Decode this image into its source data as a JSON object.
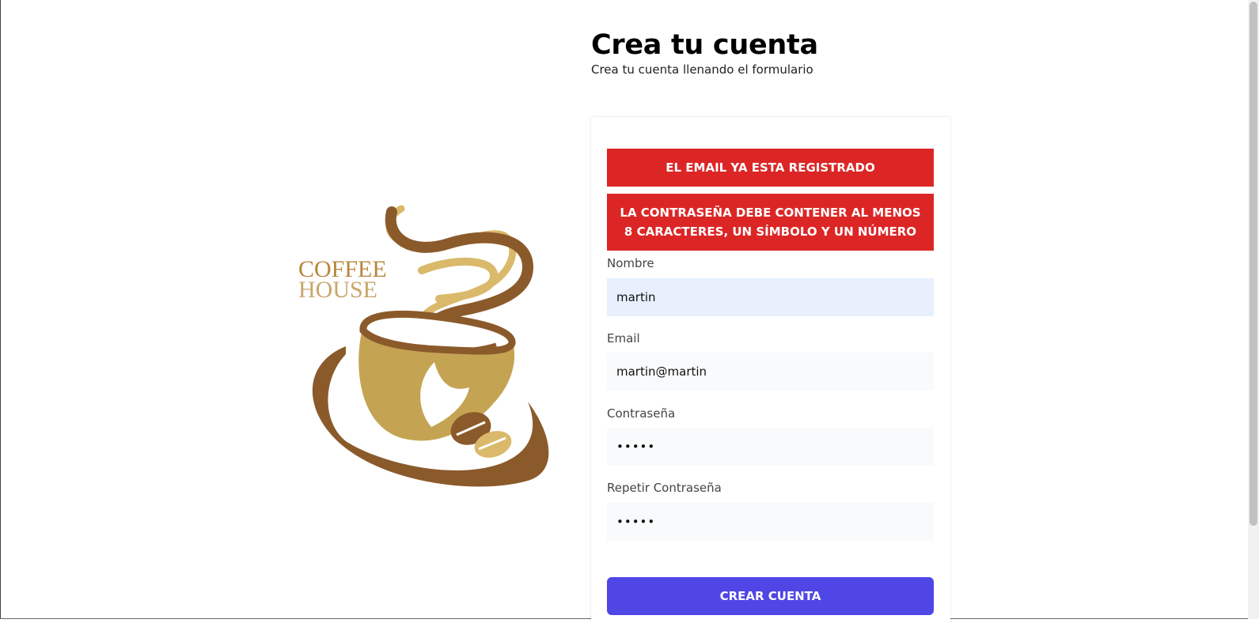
{
  "header": {
    "title": "Crea tu cuenta",
    "subtitle": "Crea tu cuenta llenando el formulario"
  },
  "logo": {
    "line1": "COFFEE",
    "line2": "HOUSE",
    "colors": {
      "brown": "#8b5a2b",
      "gold": "#c4a453",
      "light_gold": "#dab96a"
    }
  },
  "alerts": [
    "EL EMAIL YA ESTA REGISTRADO",
    "LA CONTRASEÑA DEBE CONTENER AL MENOS 8 CARACTERES, UN SÍMBOLO Y UN NÚMERO"
  ],
  "form": {
    "nombre": {
      "label": "Nombre",
      "value": "martin"
    },
    "email": {
      "label": "Email",
      "value": "martin@martin"
    },
    "password": {
      "label": "Contraseña",
      "value": "12345"
    },
    "password_confirm": {
      "label": "Repetir Contraseña",
      "value": "12345"
    },
    "submit_label": "CREAR CUENTA"
  },
  "colors": {
    "alert_bg": "#dc2626",
    "button_bg": "#4f46e5",
    "input_bg": "#f9fafb",
    "autofill_bg": "#e8f0fe"
  }
}
